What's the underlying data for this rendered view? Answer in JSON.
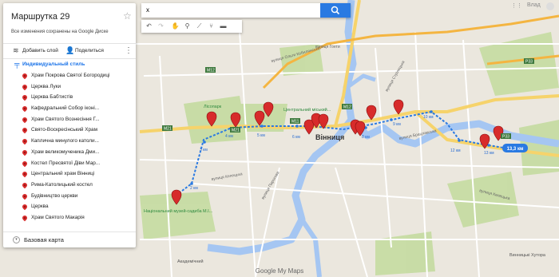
{
  "panel": {
    "title": "Маршрутка 29",
    "subtitle": "Все изменения сохранены на Google Диске",
    "add_layer": "Добавить слой",
    "share": "Поделиться",
    "style_label": "Индивидуальный стиль",
    "items": [
      "Храм Покрова Святої Богородиці",
      "Церква Луки",
      "Церква Бабтистів",
      "Кафедральний Собор іконі...",
      "Храм Святого Вознесіння Г...",
      "Свято-Воскресінський Храм",
      "Каплична минулого католи...",
      "Храм великомученика Дми...",
      "Костел Пресвятої Діви Мар...",
      "Центральний храм Вінниці",
      "Рима-Католицький костел",
      "Будівництво церкви",
      "Церква",
      "Храм Святого Макарія"
    ],
    "base_map": "Базовая карта"
  },
  "search": {
    "value": "x",
    "placeholder": ""
  },
  "topright": {
    "user": "Влад"
  },
  "map": {
    "city": "Вінниця",
    "district1": "Центральний міський...",
    "park": "Лісопарк",
    "museum": "Національний музей-садиба М.І...",
    "academic": "Академічний",
    "khutor": "Винницькі Хутора",
    "roads": [
      "M21",
      "M12",
      "M21",
      "M12",
      "M11",
      "P33",
      "P33",
      "M12"
    ],
    "streets": [
      "вулиця Келецька",
      "вулиця Келецька",
      "вулиця Пирогова",
      "вулиця Стрілецька",
      "вулиця Брацлавська",
      "вулиця Ольги Кобилянської",
      "вулиця Гонти",
      "вулиця Чехова",
      "вулиця 600-річчя",
      "вулиця Хмельницьке шосе"
    ],
    "distance_badge": "13,3 км",
    "km_labels": [
      "1 км",
      "2 км",
      "3 км",
      "4 км",
      "5 км",
      "6 км",
      "7 км",
      "8 км",
      "9 км",
      "10 км",
      "11 км",
      "12 км",
      "13 км"
    ]
  },
  "branding": "Google My Maps"
}
